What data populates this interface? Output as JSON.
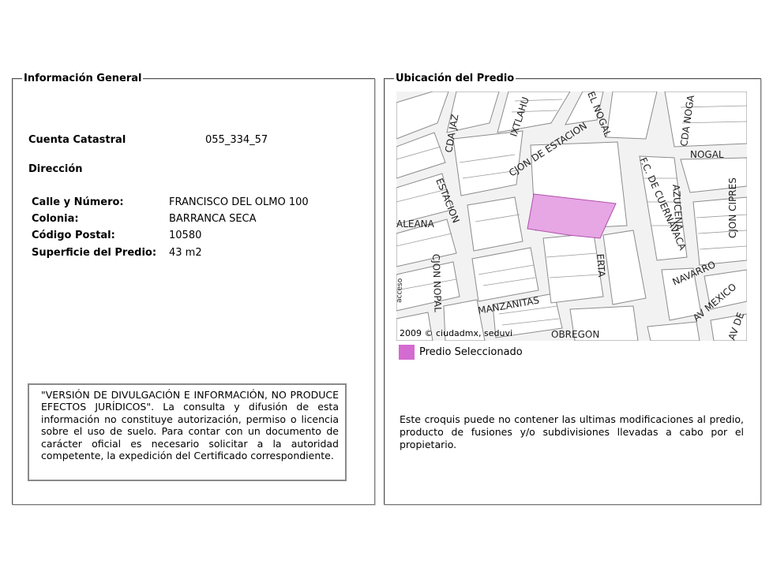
{
  "general": {
    "legend": "Información General",
    "cuenta_label": "Cuenta Catastral",
    "cuenta_value": "055_334_57",
    "direccion_heading": "Dirección",
    "calle_label": "Calle y Número:",
    "calle_value": "FRANCISCO DEL OLMO 100",
    "colonia_label": "Colonia:",
    "colonia_value": "BARRANCA SECA",
    "cp_label": "Código Postal:",
    "cp_value": "10580",
    "superficie_label": "Superficie del Predio:",
    "superficie_value": "43 m2",
    "disclaimer": "\"VERSIÓN DE DIVULGACIÓN E INFORMACIÓN, NO PRODUCE EFECTOS JURÍDICOS\". La consulta y difusión de esta información no constituye autorización, permiso o licencia sobre el uso de suelo. Para contar con un documento de carácter oficial es necesario solicitar a la autoridad competente, la expedición del Certificado correspondiente."
  },
  "location": {
    "legend": "Ubicación del Predio",
    "copyright": "2009 © ciudadmx, seduvi",
    "legend_item": "Predio Seleccionado",
    "legend_color": "#d46bd0",
    "parcel_color": "#e7a6e4",
    "note": "Este croquis puede no contener las ultimas modificaciones al predio, producto de fusiones y/o subdivisiones llevadas a cabo por el propietario.",
    "streets": {
      "cda_jaz": "CDA JAZ",
      "ixtlahu": "IXTLAHU",
      "nogal_top": "EL NOGAL",
      "cjon_estacion": "CJON DE ESTACION",
      "estacion": "ESTACION",
      "aleana": "ALEANA",
      "cjon_nopal": "CJON NOPAL",
      "manzanitas": "MANZANITAS",
      "erta": "ERTA",
      "fc_cuernavaca": "F.C. DE CUERNAVACA",
      "azucena": "AZUCENA",
      "nogal_right": "NOGAL",
      "cda_noga": "CDA NOGA",
      "cjon_cipres": "CJON CIPRES",
      "navarro": "NAVARRO",
      "av_mexico": "AV MEXICO",
      "obregon": "OBREGON",
      "av_de": "AV DE",
      "acceso": "acceso"
    }
  }
}
